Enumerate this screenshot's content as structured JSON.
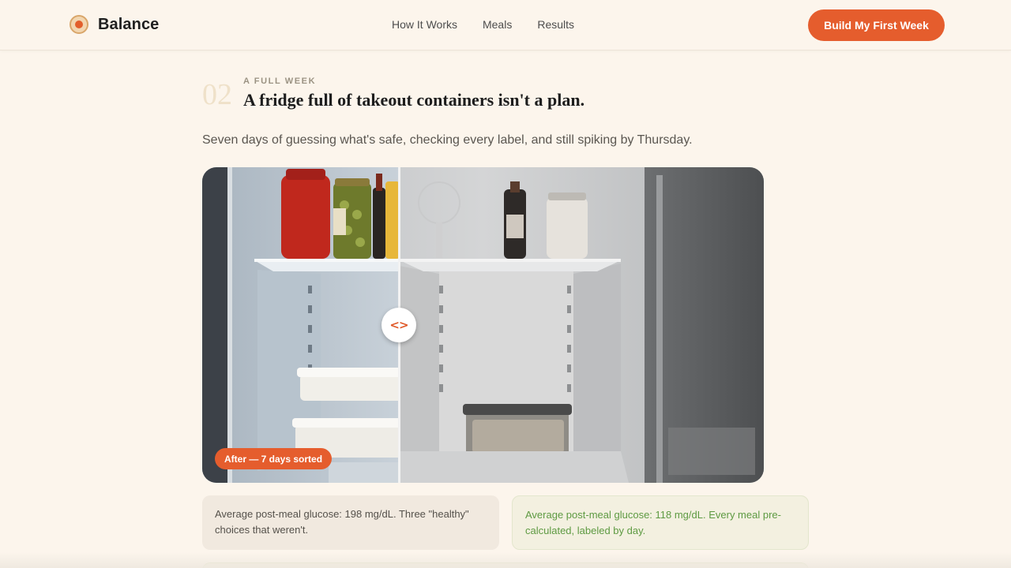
{
  "header": {
    "brand": "Balance",
    "nav": [
      "How It Works",
      "Meals",
      "Results"
    ],
    "cta": "Build My First Week"
  },
  "section": {
    "number": "02",
    "eyebrow": "A FULL WEEK",
    "title": "A fridge full of takeout containers isn't a plan.",
    "subtitle": "Seven days of guessing what's safe, checking every label, and still spiking by Thursday."
  },
  "compare": {
    "handle_glyph": "<>",
    "after_label": "After — 7 days sorted",
    "split_fraction": 0.35
  },
  "captions": {
    "before": "Average post-meal glucose: 198 mg/dL. Three \"healthy\" choices that weren't.",
    "after": "Average post-meal glucose: 118 mg/dL. Every meal pre-calculated, labeled by day."
  },
  "colors": {
    "accent": "#e55d2d",
    "background": "#fcf5ec",
    "success_text": "#5e9a42"
  }
}
